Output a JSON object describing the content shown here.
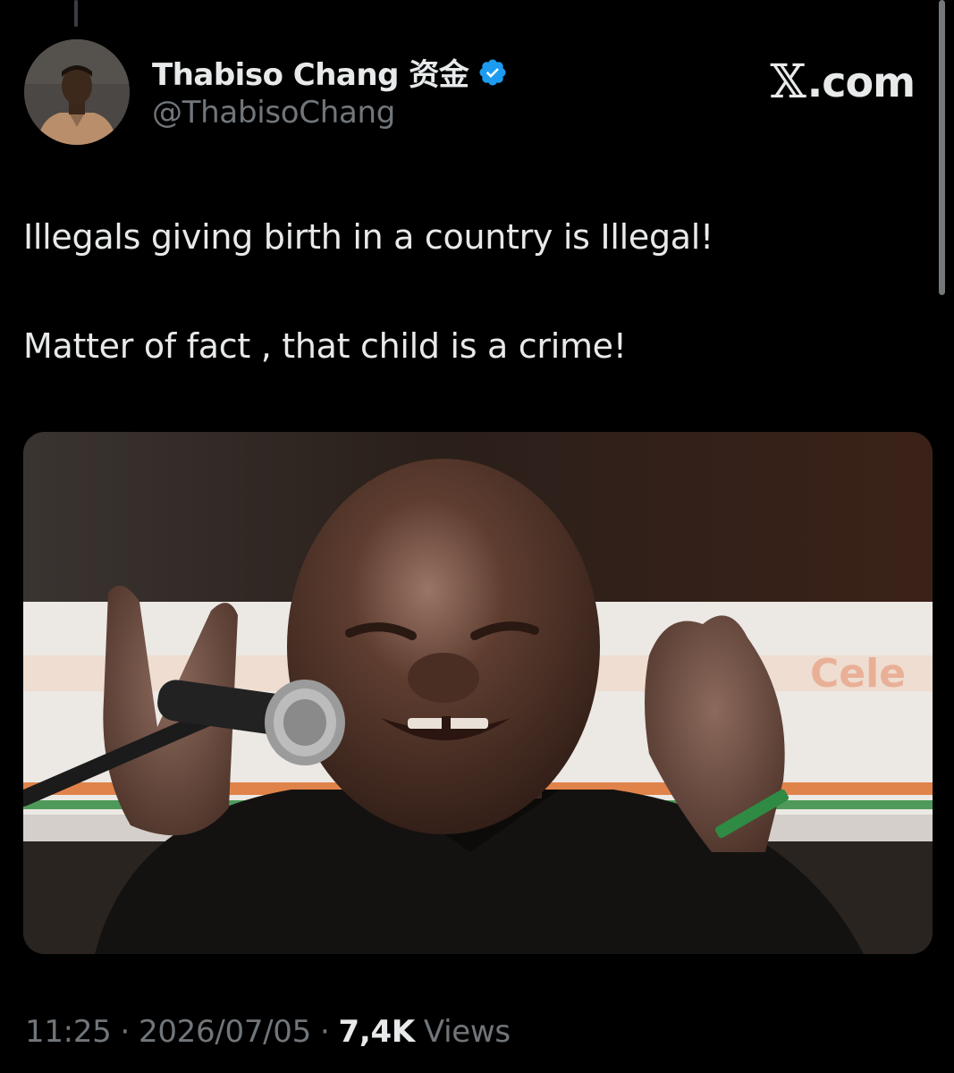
{
  "watermark": {
    "brand": "X.com"
  },
  "author": {
    "display_name": "Thabiso Chang 资金",
    "handle": "@ThabisoChang",
    "verified": true,
    "verified_color": "#1d9bf0"
  },
  "tweet": {
    "paragraphs": [
      "Illegals giving birth in a country is Illegal!",
      "Matter of fact  , that child is a crime!"
    ]
  },
  "media": {
    "type": "photo",
    "overlay_fragments": [
      "Cele"
    ]
  },
  "meta": {
    "time": "11:25",
    "separator": "·",
    "date": "2026/07/05",
    "views_count": "7,4K",
    "views_label": "Views"
  },
  "colors": {
    "background": "#000000",
    "text_primary": "#e7e9ea",
    "text_secondary": "#71767b",
    "accent": "#1d9bf0"
  }
}
